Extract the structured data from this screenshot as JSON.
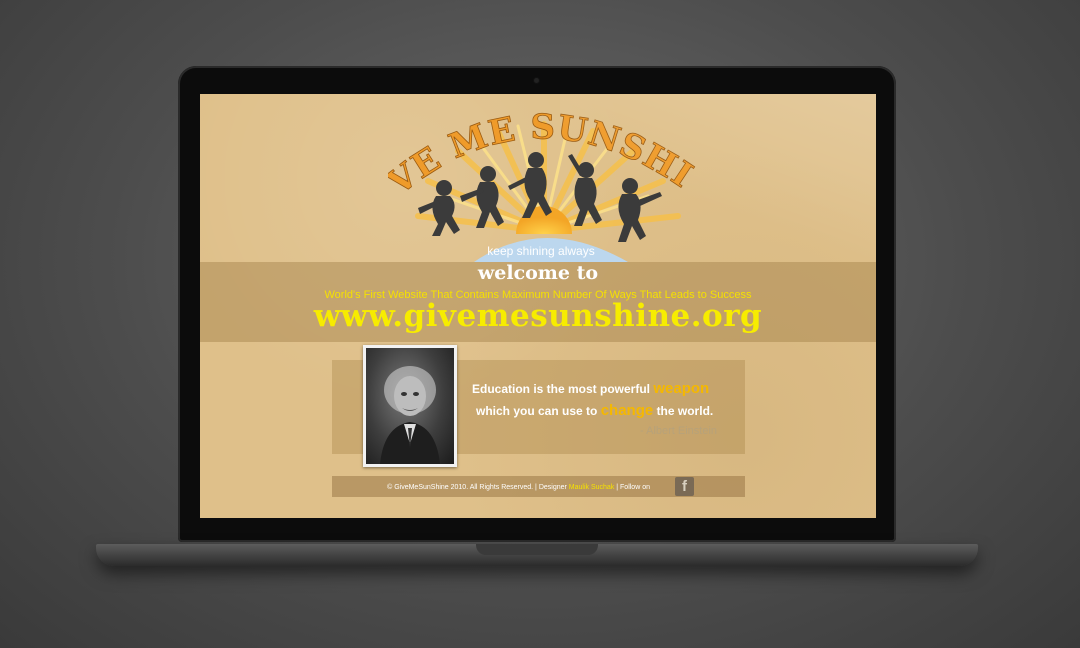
{
  "logo": {
    "title": "GIVE ME SUNSHINE",
    "tagline": "keep shining always"
  },
  "welcome": {
    "heading": "welcome to",
    "subtitle": "World's First Website That Contains Maximum Number Of Ways That Leads to Success",
    "url": "www.givemesunshine.org"
  },
  "quote": {
    "line1_prefix": "Education is the most powerful",
    "line1_keyword": "weapon",
    "line2_prefix": "which you can use to",
    "line2_keyword": "change",
    "line2_suffix": "the world.",
    "author": "- Albert Einstein"
  },
  "footer": {
    "copyright": "© GiveMeSunShine 2010. All Rights Reserved. | Designer",
    "designer": "Maulik Suchak",
    "follow": "| Follow on",
    "social_icon": "facebook-icon"
  },
  "colors": {
    "page_bg": "#dfc08a",
    "accent_yellow": "#f7ec00",
    "keyword_orange": "#f5b800",
    "logo_orange": "#ef9b2a"
  }
}
